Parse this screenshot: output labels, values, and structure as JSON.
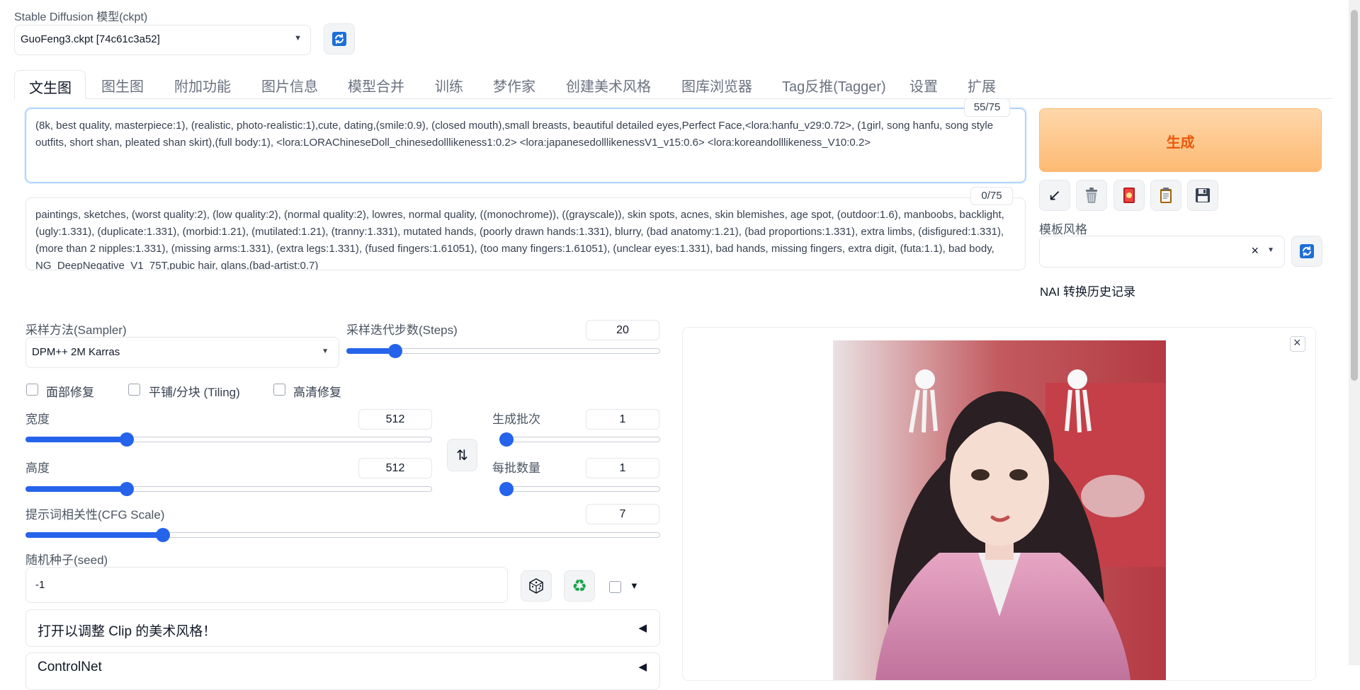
{
  "model": {
    "label": "Stable Diffusion 模型(ckpt)",
    "value": "GuoFeng3.ckpt [74c61c3a52]"
  },
  "tabs": [
    "文生图",
    "图生图",
    "附加功能",
    "图片信息",
    "模型合并",
    "训练",
    "梦作家",
    "创建美术风格",
    "图库浏览器",
    "Tag反推(Tagger)",
    "设置",
    "扩展"
  ],
  "active_tab": "文生图",
  "prompt": {
    "text": "(8k, best quality, masterpiece:1), (realistic, photo-realistic:1),cute, dating,(smile:0.9), (closed mouth),small breasts, beautiful detailed eyes,Perfect Face,<lora:hanfu_v29:0.72>, (1girl, song hanfu, song style outfits, short shan, pleated shan skirt),(full body:1), <lora:LORAChineseDoll_chinesedolllikeness1:0.2> <lora:japanesedolllikenessV1_v15:0.6> <lora:koreandolllikeness_V10:0.2>",
    "counter": "55/75"
  },
  "negative_prompt": {
    "text": "paintings, sketches, (worst quality:2), (low quality:2), (normal quality:2), lowres, normal quality, ((monochrome)), ((grayscale)), skin spots, acnes, skin blemishes, age spot, (outdoor:1.6), manboobs, backlight,(ugly:1.331), (duplicate:1.331), (morbid:1.21), (mutilated:1.21), (tranny:1.331), mutated hands, (poorly drawn hands:1.331), blurry, (bad anatomy:1.21), (bad proportions:1.331), extra limbs, (disfigured:1.331), (more than 2 nipples:1.331), (missing arms:1.331), (extra legs:1.331), (fused fingers:1.61051), (too many fingers:1.61051), (unclear eyes:1.331), bad hands, missing fingers, extra digit, (futa:1.1), bad body, NG_DeepNegative_V1_75T,pubic hair, glans,(bad-artist:0.7)",
    "counter": "0/75"
  },
  "generate_label": "生成",
  "tool_icons": [
    "arrow-down-left-icon",
    "trash-icon",
    "red-card-icon",
    "clipboard-icon",
    "save-icon"
  ],
  "style": {
    "label": "模板风格",
    "value": ""
  },
  "nai_label": "NAI 转换历史记录",
  "sampler": {
    "label": "采样方法(Sampler)",
    "value": "DPM++ 2M Karras"
  },
  "steps": {
    "label": "采样迭代步数(Steps)",
    "value": "20",
    "fraction": 0.14
  },
  "checkboxes": [
    "面部修复",
    "平铺/分块 (Tiling)",
    "高清修复"
  ],
  "width": {
    "label": "宽度",
    "value": "512",
    "fraction": 0.24
  },
  "height": {
    "label": "高度",
    "value": "512",
    "fraction": 0.24
  },
  "batch_count": {
    "label": "生成批次",
    "value": "1",
    "fraction": 0.0
  },
  "batch_size": {
    "label": "每批数量",
    "value": "1",
    "fraction": 0.0
  },
  "cfg": {
    "label": "提示词相关性(CFG Scale)",
    "value": "7",
    "fraction": 0.21
  },
  "seed": {
    "label": "随机种子(seed)",
    "value": "-1"
  },
  "accordions": [
    {
      "label": "打开以调整 Clip 的美术风格！"
    },
    {
      "label": "ControlNet"
    }
  ],
  "colors": {
    "accent": "#2563eb",
    "generate_bg": "#fdba74",
    "generate_text": "#ea580c"
  }
}
